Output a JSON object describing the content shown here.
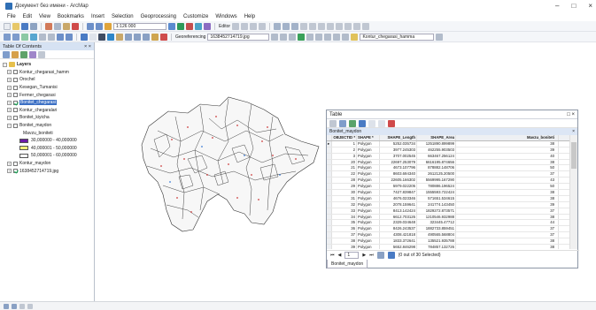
{
  "window": {
    "title": "Документ без имени - ArcMap",
    "controls": [
      "–",
      "□",
      "×"
    ]
  },
  "menu": [
    "File",
    "Edit",
    "View",
    "Bookmarks",
    "Insert",
    "Selection",
    "Geoprocessing",
    "Customize",
    "Windows",
    "Help"
  ],
  "toolbar": {
    "scale": "1:126 000",
    "editor": "Editor",
    "georeferencing": "Georeferencing",
    "raster_select": "1638452714719.jpg",
    "layer_select": "Kontur_chegarasi_hamma"
  },
  "toc": {
    "title": "Table Of Contents",
    "close": "× ×",
    "items": [
      {
        "label": "Layers",
        "kind": "group",
        "expanded": true,
        "checked": false
      },
      {
        "label": "Kontur_chegarasi_hamm",
        "checked": false
      },
      {
        "label": "Orochel",
        "checked": false
      },
      {
        "label": "Kesegan_Tumanisi",
        "checked": false
      },
      {
        "label": "Fermer_chegarasi",
        "checked": false
      },
      {
        "label": "Bonitet_chegarasi",
        "checked": true,
        "selected": true
      },
      {
        "label": "Kontur_chegaralari",
        "checked": false
      },
      {
        "label": "Bonitet_kiyicha",
        "checked": false
      },
      {
        "label": "Bonitet_maydon",
        "checked": false,
        "expanded": true
      },
      {
        "label": "Mavzu_boniteti",
        "kind": "sublabel"
      },
      {
        "label": "30,000000 - 40,000000",
        "kind": "legend",
        "color": "#6a1aa8"
      },
      {
        "label": "40,000001 - 50,000000",
        "kind": "legend",
        "color": "#f2ef7a"
      },
      {
        "label": "50,000001 - 60,000000",
        "kind": "legend",
        "color": "#ffffff"
      },
      {
        "label": "Kontur_maydon",
        "checked": false
      },
      {
        "label": "1638452714719.jpg",
        "checked": true
      }
    ]
  },
  "table": {
    "title": "Table",
    "close": "□ ×",
    "layer_name": "Bonitet_maydon",
    "columns": [
      "OBJECTID *",
      "SHAPE *",
      "SHAPE_Length",
      "SHAPE_Area",
      "Mavzu_boniteti"
    ],
    "rows": [
      [
        "1",
        "Polygon",
        "5252.035734",
        "1251890.899899",
        "38"
      ],
      [
        "2",
        "Polygon",
        "3977.245303",
        "462255.903503",
        "39"
      ],
      [
        "3",
        "Polygon",
        "3707.002545",
        "663467.256124",
        "40"
      ],
      [
        "20",
        "Polygon",
        "22697.253079",
        "6616195.874656",
        "38"
      ],
      [
        "21",
        "Polygon",
        "4673.107796",
        "878882.148706",
        "50"
      ],
      [
        "22",
        "Polygon",
        "8603.694340",
        "2612125.20500",
        "37"
      ],
      [
        "28",
        "Polygon",
        "22605.166302",
        "5569995.167290",
        "43"
      ],
      [
        "29",
        "Polygon",
        "5979.022205",
        "780886.196524",
        "50"
      ],
      [
        "30",
        "Polygon",
        "7427.839847",
        "1555593.722424",
        "38"
      ],
      [
        "31",
        "Polygon",
        "4676.023346",
        "571651.534615",
        "38"
      ],
      [
        "32",
        "Polygon",
        "2078.159641",
        "241774.143450",
        "39"
      ],
      [
        "33",
        "Polygon",
        "8413.142424",
        "1829272.873571",
        "37"
      ],
      [
        "34",
        "Polygon",
        "6612.703126",
        "1210546.932988",
        "38"
      ],
      [
        "35",
        "Polygon",
        "2329.034648",
        "323445.47712",
        "44"
      ],
      [
        "36",
        "Polygon",
        "8426.243537",
        "1882733.859451",
        "37"
      ],
      [
        "37",
        "Polygon",
        "4308.421818",
        "490565.568804",
        "37"
      ],
      [
        "38",
        "Polygon",
        "1833.372641",
        "135521.935788",
        "38"
      ],
      [
        "39",
        "Polygon",
        "5652.846298",
        "784857.132726",
        "38"
      ],
      [
        "40",
        "Polygon",
        "7796.304811",
        "823321.692501",
        "37"
      ],
      [
        "42",
        "Polygon",
        "6111.56968",
        "2871830.773486",
        "36"
      ]
    ],
    "status_counter": "1",
    "selection_text": "(0 out of 30 Selected)",
    "tab_label": "Bonitet_maydon"
  }
}
